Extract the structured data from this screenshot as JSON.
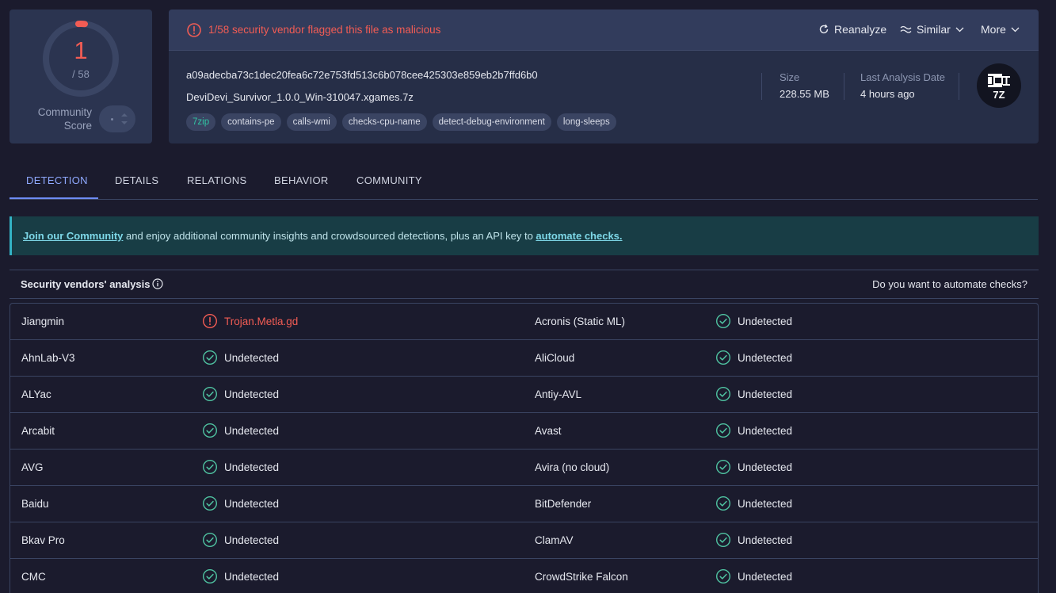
{
  "score": {
    "detections": "1",
    "total": "/ 58",
    "community_label_line1": "Community",
    "community_label_line2": "Score"
  },
  "file": {
    "alert": "1/58 security vendor flagged this file as malicious",
    "actions": {
      "reanalyze": "Reanalyze",
      "similar": "Similar",
      "more": "More"
    },
    "hash": "a09adecba73c1dec20fea6c72e753fd513c6b078cee425303e859eb2b7ffd6b0",
    "name": "DeviDevi_Survivor_1.0.0_Win-310047.xgames.7z",
    "tags": [
      "7zip",
      "contains-pe",
      "calls-wmi",
      "checks-cpu-name",
      "detect-debug-environment",
      "long-sleeps"
    ],
    "size_label": "Size",
    "size_value": "228.55 MB",
    "date_label": "Last Analysis Date",
    "date_value": "4 hours ago",
    "type_badge": "7Z"
  },
  "tabs": [
    "DETECTION",
    "DETAILS",
    "RELATIONS",
    "BEHAVIOR",
    "COMMUNITY"
  ],
  "banner": {
    "link1": "Join our Community",
    "middle": " and enjoy additional community insights and crowdsourced detections, plus an API key to ",
    "link2": "automate checks."
  },
  "vendors_header": {
    "title": "Security vendors' analysis",
    "right": "Do you want to automate checks?"
  },
  "vendors": [
    [
      {
        "name": "Jiangmin",
        "result": "Trojan.Metla.gd",
        "malicious": true
      },
      {
        "name": "Acronis (Static ML)",
        "result": "Undetected",
        "malicious": false
      }
    ],
    [
      {
        "name": "AhnLab-V3",
        "result": "Undetected",
        "malicious": false
      },
      {
        "name": "AliCloud",
        "result": "Undetected",
        "malicious": false
      }
    ],
    [
      {
        "name": "ALYac",
        "result": "Undetected",
        "malicious": false
      },
      {
        "name": "Antiy-AVL",
        "result": "Undetected",
        "malicious": false
      }
    ],
    [
      {
        "name": "Arcabit",
        "result": "Undetected",
        "malicious": false
      },
      {
        "name": "Avast",
        "result": "Undetected",
        "malicious": false
      }
    ],
    [
      {
        "name": "AVG",
        "result": "Undetected",
        "malicious": false
      },
      {
        "name": "Avira (no cloud)",
        "result": "Undetected",
        "malicious": false
      }
    ],
    [
      {
        "name": "Baidu",
        "result": "Undetected",
        "malicious": false
      },
      {
        "name": "BitDefender",
        "result": "Undetected",
        "malicious": false
      }
    ],
    [
      {
        "name": "Bkav Pro",
        "result": "Undetected",
        "malicious": false
      },
      {
        "name": "ClamAV",
        "result": "Undetected",
        "malicious": false
      }
    ],
    [
      {
        "name": "CMC",
        "result": "Undetected",
        "malicious": false
      },
      {
        "name": "CrowdStrike Falcon",
        "result": "Undetected",
        "malicious": false
      }
    ]
  ],
  "colors": {
    "malicious": "#f25c54",
    "clean": "#4fc3a1",
    "accent": "#8fa9ff"
  }
}
